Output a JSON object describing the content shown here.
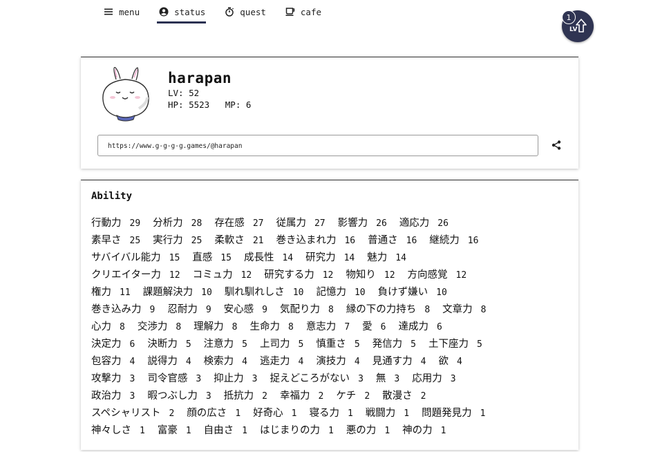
{
  "nav": {
    "tabs": [
      {
        "label": "menu",
        "icon": "menu-icon"
      },
      {
        "label": "status",
        "icon": "account-circle-icon",
        "active": true
      },
      {
        "label": "quest",
        "icon": "timer-icon"
      },
      {
        "label": "cafe",
        "icon": "coffee-icon"
      }
    ]
  },
  "level_badge": {
    "count": "1",
    "label": "LV"
  },
  "profile": {
    "name": "harapan",
    "lv": "LV: 52",
    "hp_mp": "HP: 5523   MP: 6",
    "url": "https://www.g-g-g-g.games/@harapan"
  },
  "ability": {
    "title": "Ability",
    "rows": [
      [
        [
          "行動力",
          "29"
        ],
        [
          "分析力",
          "28"
        ],
        [
          "存在感",
          "27"
        ],
        [
          "従属力",
          "27"
        ],
        [
          "影響力",
          "26"
        ],
        [
          "適応力",
          "26"
        ]
      ],
      [
        [
          "素早さ",
          "25"
        ],
        [
          "実行力",
          "25"
        ],
        [
          "柔軟さ",
          "21"
        ],
        [
          "巻き込まれ力",
          "16"
        ],
        [
          "普通さ",
          "16"
        ],
        [
          "継続力",
          "16"
        ]
      ],
      [
        [
          "サバイバル能力",
          "15"
        ],
        [
          "直感",
          "15"
        ],
        [
          "成長性",
          "14"
        ],
        [
          "研究力",
          "14"
        ],
        [
          "魅力",
          "14"
        ]
      ],
      [
        [
          "クリエイター力",
          "12"
        ],
        [
          "コミュ力",
          "12"
        ],
        [
          "研究する力",
          "12"
        ],
        [
          "物知り",
          "12"
        ],
        [
          "方向感覚",
          "12"
        ]
      ],
      [
        [
          "権力",
          "11"
        ],
        [
          "課題解決力",
          "10"
        ],
        [
          "馴れ馴れしさ",
          "10"
        ],
        [
          "記憶力",
          "10"
        ],
        [
          "負けず嫌い",
          "10"
        ]
      ],
      [
        [
          "巻き込み力",
          "9"
        ],
        [
          "忍耐力",
          "9"
        ],
        [
          "安心感",
          "9"
        ],
        [
          "気配り力",
          "8"
        ],
        [
          "縁の下の力持ち",
          "8"
        ],
        [
          "文章力",
          "8"
        ]
      ],
      [
        [
          "心力",
          "8"
        ],
        [
          "交渉力",
          "8"
        ],
        [
          "理解力",
          "8"
        ],
        [
          "生命力",
          "8"
        ],
        [
          "意志力",
          "7"
        ],
        [
          "愛",
          "6"
        ],
        [
          "達成力",
          "6"
        ]
      ],
      [
        [
          "決定力",
          "6"
        ],
        [
          "決断力",
          "5"
        ],
        [
          "注意力",
          "5"
        ],
        [
          "上司力",
          "5"
        ],
        [
          "慎重さ",
          "5"
        ],
        [
          "発信力",
          "5"
        ],
        [
          "土下座力",
          "5"
        ]
      ],
      [
        [
          "包容力",
          "4"
        ],
        [
          "説得力",
          "4"
        ],
        [
          "検索力",
          "4"
        ],
        [
          "逃走力",
          "4"
        ],
        [
          "演技力",
          "4"
        ],
        [
          "見通す力",
          "4"
        ],
        [
          "欲",
          "4"
        ]
      ],
      [
        [
          "攻撃力",
          "3"
        ],
        [
          "司令官感",
          "3"
        ],
        [
          "抑止力",
          "3"
        ],
        [
          "捉えどころがない",
          "3"
        ],
        [
          "無",
          "3"
        ],
        [
          "応用力",
          "3"
        ]
      ],
      [
        [
          "政治力",
          "3"
        ],
        [
          "暇つぶし力",
          "3"
        ],
        [
          "抵抗力",
          "2"
        ],
        [
          "幸福力",
          "2"
        ],
        [
          "ケチ",
          "2"
        ],
        [
          "散漫さ",
          "2"
        ]
      ],
      [
        [
          "スペシャリスト",
          "2"
        ],
        [
          "顔の広さ",
          "1"
        ],
        [
          "好奇心",
          "1"
        ],
        [
          "寝る力",
          "1"
        ],
        [
          "戦闘力",
          "1"
        ],
        [
          "問題発見力",
          "1"
        ]
      ],
      [
        [
          "神々しさ",
          "1"
        ],
        [
          "富豪",
          "1"
        ],
        [
          "自由さ",
          "1"
        ],
        [
          "はじまりの力",
          "1"
        ],
        [
          "悪の力",
          "1"
        ],
        [
          "神の力",
          "1"
        ]
      ]
    ]
  },
  "colors": {
    "accent": "#2f3452",
    "border": "#333333"
  }
}
